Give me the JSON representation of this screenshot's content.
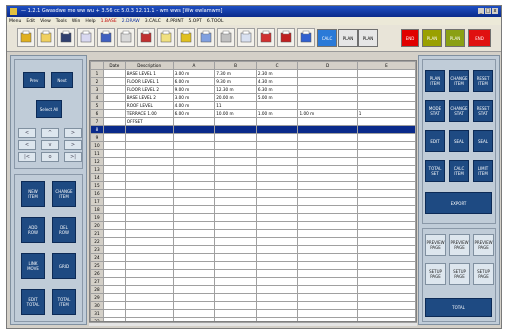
{
  "window": {
    "title": "— 1.2.1 Gwasdwe me ww wu + 3.56 cc 5.0.3 12.11.1 - wm wws [Ww ewlamwm]",
    "controls": [
      "_",
      "□",
      "x"
    ]
  },
  "menu": [
    {
      "label": "Menu",
      "color": "normal"
    },
    {
      "label": "Edit",
      "color": "normal"
    },
    {
      "label": "View",
      "color": "normal"
    },
    {
      "label": "Tools",
      "color": "normal"
    },
    {
      "label": "Win",
      "color": "normal"
    },
    {
      "label": "Help",
      "color": "normal"
    },
    {
      "label": "1.BASE",
      "color": "red"
    },
    {
      "label": "2.DRAW",
      "color": "blue"
    },
    {
      "label": "3.CALC",
      "color": "normal"
    },
    {
      "label": "4.PRINT",
      "color": "normal"
    },
    {
      "label": "5.OPT",
      "color": "normal"
    },
    {
      "label": "6.TOOL",
      "color": "normal"
    }
  ],
  "toolbar": {
    "icons": [
      "folder-icon",
      "file-icon",
      "save-icon",
      "copy-icon",
      "chart-icon",
      "list-icon",
      "edit-icon",
      "layout-icon",
      "tool-icon",
      "undo-icon",
      "table-icon",
      "search-icon",
      "print-icon",
      "check-icon",
      "calc-icon"
    ],
    "text_buttons": [
      {
        "label": "CALC",
        "bg": "#2a7ad8",
        "fg": "#ffffff"
      },
      {
        "label": "PLAN",
        "bg": "#e6e6e6",
        "fg": "#000000"
      },
      {
        "label": "PLAN",
        "bg": "#e6e6e6",
        "fg": "#000000"
      }
    ],
    "color_buttons": [
      {
        "label": "END",
        "bg": "#e00000",
        "fg": "#ffffff"
      },
      {
        "label": "PLAN",
        "bg": "#9aa000",
        "fg": "#ffffff"
      },
      {
        "label": "PLAN",
        "bg": "#8aa014",
        "fg": "#ffffff"
      },
      {
        "label": "END",
        "bg": "#e01010",
        "fg": "#ffffff"
      }
    ]
  },
  "left_panel": {
    "top_buttons": [
      "Prev",
      "Next"
    ],
    "mid_button": "Select\nAll",
    "small_buttons": [
      "<",
      "^",
      ">",
      "<",
      "v",
      ">",
      "|<",
      "o",
      ">|"
    ],
    "action_buttons": [
      "NEW\nITEM",
      "CHANGE\nITEM",
      "ADD\nROW",
      "DEL\nROW",
      "LINK\nMOVE",
      "GRID",
      "EDIT\nTOTAL",
      "TOTAL\nITEM"
    ]
  },
  "right_panel": {
    "top_buttons": [
      "PLAN\nITEM",
      "CHANGE\nITEM",
      "RESET\nITEM",
      "MODE\nSTAT",
      "CHANGE\nSTAT",
      "RESET\nSTAT",
      "EDIT",
      "SEAL",
      "SEAL",
      "TOTAL\nSET",
      "CALC\nITEM",
      "LIMIT\nITEM"
    ],
    "wide_button": "EXPORT",
    "gray_buttons": [
      "PREVIEW\nPAGE",
      "PREVIEW\nPAGE",
      "PREVIEW\nPAGE",
      "SETUP\nPAGE",
      "SETUP\nPAGE",
      "SETUP\nPAGE"
    ],
    "bottom_button": "TOTAL"
  },
  "grid": {
    "headers": [
      "",
      "Date",
      "Description",
      "A",
      "B",
      "C",
      "D",
      "E"
    ],
    "rows": [
      [
        "1",
        "",
        "BASE LEVEL 1",
        "3.00 m",
        "7.30 m",
        "2.30 m",
        "",
        ""
      ],
      [
        "2",
        "",
        "FLOOR LEVEL 1",
        "6.00 m",
        "9.30 m",
        "4.30 m",
        "",
        ""
      ],
      [
        "3",
        "",
        "FLOOR LEVEL 2",
        "9.00 m",
        "12.30 m",
        "6.30 m",
        "",
        ""
      ],
      [
        "4",
        "",
        "BASE LEVEL 2",
        "3.00 m",
        "20.00 m",
        "5.00 m",
        "",
        ""
      ],
      [
        "5",
        "",
        "ROOF LEVEL",
        "4.00 m",
        "11",
        "",
        "",
        ""
      ],
      [
        "6",
        "",
        "TERRACE 1.00",
        "6.00 m",
        "10.00 m",
        "1.00 m",
        "1.00 m",
        "1"
      ],
      [
        "7",
        "",
        "OFFSET",
        "",
        "",
        "",
        "",
        ""
      ],
      [
        "8",
        "",
        "",
        "",
        "",
        "",
        "",
        ""
      ],
      [
        "9",
        "",
        "",
        "",
        "",
        "",
        "",
        ""
      ],
      [
        "10",
        "",
        "",
        "",
        "",
        "",
        "",
        ""
      ],
      [
        "11",
        "",
        "",
        "",
        "",
        "",
        "",
        ""
      ],
      [
        "12",
        "",
        "",
        "",
        "",
        "",
        "",
        ""
      ],
      [
        "13",
        "",
        "",
        "",
        "",
        "",
        "",
        ""
      ],
      [
        "14",
        "",
        "",
        "",
        "",
        "",
        "",
        ""
      ],
      [
        "15",
        "",
        "",
        "",
        "",
        "",
        "",
        ""
      ],
      [
        "16",
        "",
        "",
        "",
        "",
        "",
        "",
        ""
      ],
      [
        "17",
        "",
        "",
        "",
        "",
        "",
        "",
        ""
      ],
      [
        "18",
        "",
        "",
        "",
        "",
        "",
        "",
        ""
      ],
      [
        "19",
        "",
        "",
        "",
        "",
        "",
        "",
        ""
      ],
      [
        "20",
        "",
        "",
        "",
        "",
        "",
        "",
        ""
      ],
      [
        "21",
        "",
        "",
        "",
        "",
        "",
        "",
        ""
      ],
      [
        "22",
        "",
        "",
        "",
        "",
        "",
        "",
        ""
      ],
      [
        "23",
        "",
        "",
        "",
        "",
        "",
        "",
        ""
      ],
      [
        "24",
        "",
        "",
        "",
        "",
        "",
        "",
        ""
      ],
      [
        "25",
        "",
        "",
        "",
        "",
        "",
        "",
        ""
      ],
      [
        "26",
        "",
        "",
        "",
        "",
        "",
        "",
        ""
      ],
      [
        "27",
        "",
        "",
        "",
        "",
        "",
        "",
        ""
      ],
      [
        "28",
        "",
        "",
        "",
        "",
        "",
        "",
        ""
      ],
      [
        "29",
        "",
        "",
        "",
        "",
        "",
        "",
        ""
      ],
      [
        "30",
        "",
        "",
        "",
        "",
        "",
        "",
        ""
      ],
      [
        "31",
        "",
        "",
        "",
        "",
        "",
        "",
        ""
      ],
      [
        "32",
        "",
        "",
        "",
        "",
        "",
        "",
        ""
      ],
      [
        "33",
        "",
        "",
        "",
        "",
        "",
        "",
        ""
      ]
    ],
    "selected_row": 7,
    "selected_marker": "▶"
  }
}
